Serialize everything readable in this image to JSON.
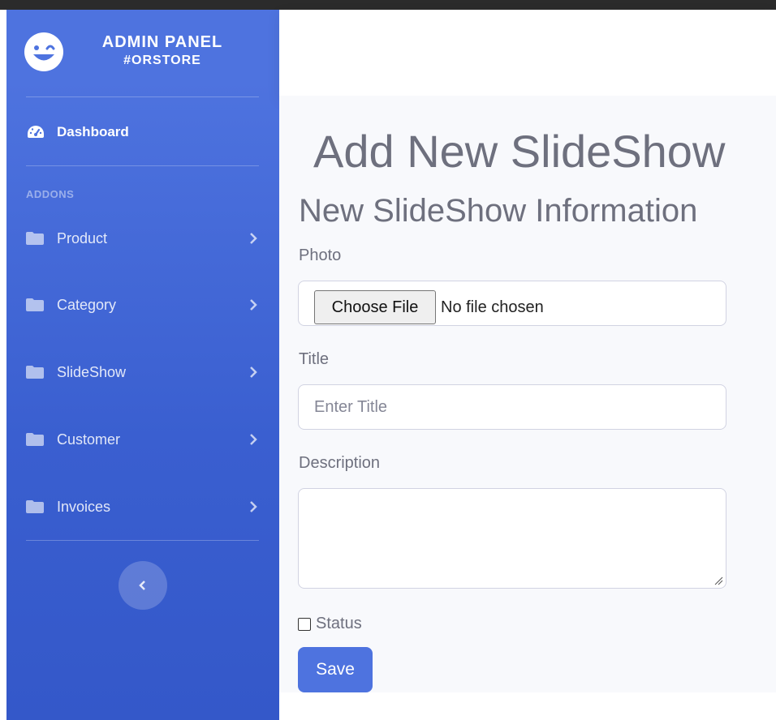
{
  "sidebar": {
    "brand_line1": "ADMIN PANEL",
    "brand_line2": "#ORSTORE",
    "dashboard_label": "Dashboard",
    "section_heading": "ADDONS",
    "items": [
      {
        "label": "Product",
        "icon": "folder-icon"
      },
      {
        "label": "Category",
        "icon": "folder-icon"
      },
      {
        "label": "SlideShow",
        "icon": "folder-icon"
      },
      {
        "label": "Customer",
        "icon": "folder-icon"
      },
      {
        "label": "Invoices",
        "icon": "folder-icon"
      }
    ]
  },
  "main": {
    "page_title": "Add New SlideShow",
    "section_title": "New SlideShow Information",
    "photo_label": "Photo",
    "file_button_label": "Choose File",
    "file_status": "No file chosen",
    "title_label": "Title",
    "title_placeholder": "Enter Title",
    "description_label": "Description",
    "status_label": "Status",
    "save_label": "Save"
  },
  "colors": {
    "sidebar": "#4e73df",
    "primary_button": "#4e73df",
    "content_bg": "#f8f9fc"
  }
}
